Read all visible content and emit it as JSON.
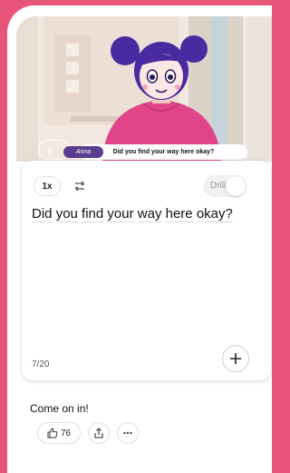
{
  "scene": {
    "character_name": "Anna",
    "caption": "Did you find your way here okay?",
    "exit_label_partial": "E"
  },
  "card": {
    "speed_label": "1x",
    "drill_label": "Drill",
    "sentence": [
      "Did",
      "you",
      "find",
      "your",
      "way",
      "here",
      "okay?"
    ],
    "progress": "7/20"
  },
  "reply": {
    "text": "Come on in!",
    "like_count": "76"
  },
  "colors": {
    "background": "#e8557a",
    "character_shirt": "#e0458a",
    "hair": "#4a2aa0",
    "name_tag": "#5b3d8e"
  },
  "icons": [
    "loop-icon",
    "plus-icon",
    "thumbs-up-icon",
    "share-icon",
    "more-icon"
  ]
}
